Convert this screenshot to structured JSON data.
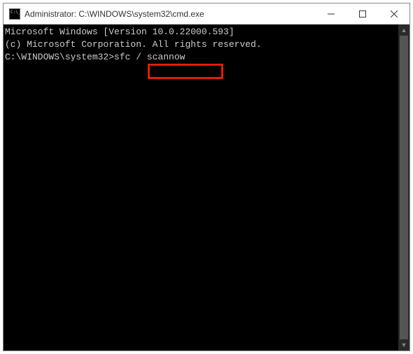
{
  "titlebar": {
    "title": "Administrator: C:\\WINDOWS\\system32\\cmd.exe"
  },
  "console": {
    "line1": "Microsoft Windows [Version 10.0.22000.593]",
    "line2": "(c) Microsoft Corporation. All rights reserved.",
    "blank": "",
    "prompt": "C:\\WINDOWS\\system32>",
    "command_prefix": "sfc ",
    "command_highlighted": "/ scannow"
  }
}
